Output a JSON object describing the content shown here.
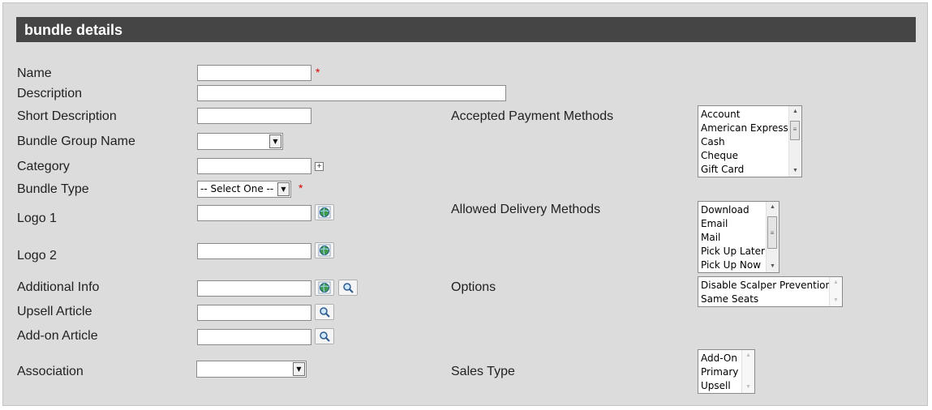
{
  "header": {
    "title": "bundle details"
  },
  "required_marker": "*",
  "left": {
    "name_label": "Name",
    "description_label": "Description",
    "short_description_label": "Short Description",
    "bundle_group_label": "Bundle Group Name",
    "category_label": "Category",
    "bundle_type_label": "Bundle Type",
    "bundle_type_value": "-- Select One --",
    "logo1_label": "Logo 1",
    "logo2_label": "Logo 2",
    "additional_info_label": "Additional Info",
    "upsell_label": "Upsell Article",
    "addon_label": "Add-on Article",
    "association_label": "Association"
  },
  "right": {
    "payment_label": "Accepted Payment Methods",
    "payment_options": [
      "Account",
      "American Express",
      "Cash",
      "Cheque",
      "Gift Card"
    ],
    "delivery_label": "Allowed Delivery Methods",
    "delivery_options": [
      "Download",
      "Email",
      "Mail",
      "Pick Up Later",
      "Pick Up Now"
    ],
    "options_label": "Options",
    "options_options": [
      "Disable Scalper Prevention",
      "Same Seats"
    ],
    "sales_type_label": "Sales Type",
    "sales_type_options": [
      "Add-On",
      "Primary",
      "Upsell"
    ]
  },
  "icons": {
    "globe": "globe-icon",
    "magnifier": "magnifier-icon",
    "add": "plus-box-icon",
    "dropdown": "chevron-down-icon"
  }
}
